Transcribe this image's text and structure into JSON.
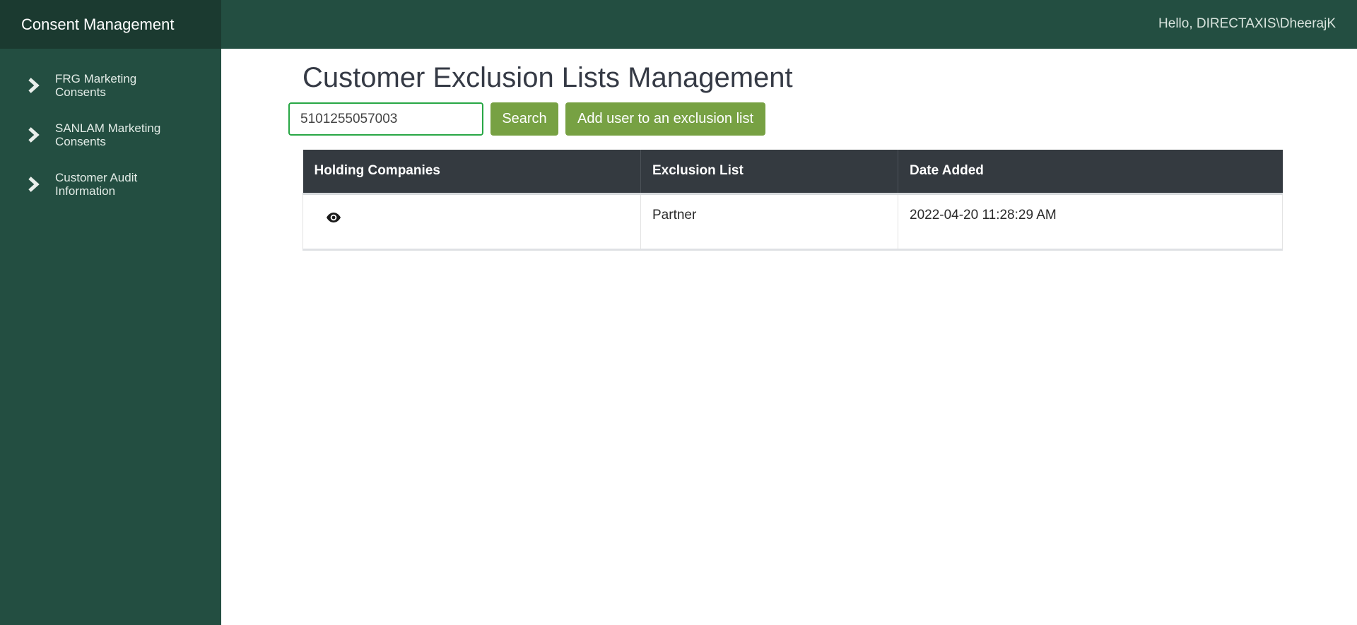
{
  "app": {
    "brand": "Consent Management"
  },
  "topbar": {
    "greeting": "Hello, DIRECTAXIS\\DheerajK"
  },
  "sidebar": {
    "items": [
      {
        "line1": "FRG Marketing",
        "line2": "Consents",
        "icon": "chevron-right-icon"
      },
      {
        "line1": "SANLAM Marketing",
        "line2": "Consents",
        "icon": "chevron-right-icon"
      },
      {
        "line1": "Customer Audit",
        "line2": "Information",
        "icon": "chevron-right-icon"
      }
    ]
  },
  "main": {
    "title": "Customer Exclusion Lists Management",
    "search": {
      "value": "5101255057003"
    },
    "buttons": {
      "search": "Search",
      "add": "Add user to an exclusion list"
    },
    "table": {
      "headers": [
        "Holding Companies",
        "Exclusion List",
        "Date Added"
      ],
      "rows": [
        {
          "holding_icon": "eye-icon",
          "exclusion_list": "Partner",
          "date_added": "2022-04-20 11:28:29 AM"
        }
      ]
    }
  },
  "colors": {
    "sidebar": "#234e41",
    "brand_bar": "#1b3a30",
    "button": "#77a143",
    "table_header": "#343a40",
    "input_border": "#28a745"
  }
}
